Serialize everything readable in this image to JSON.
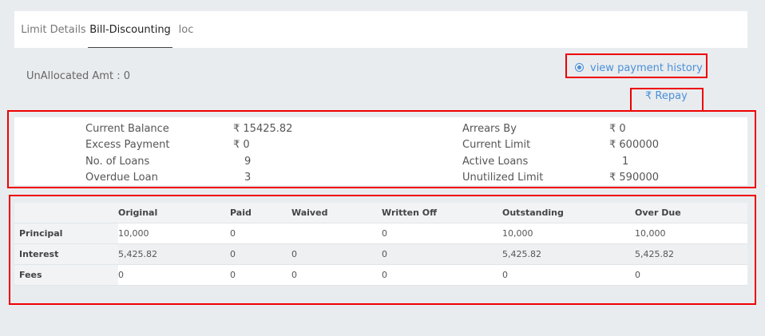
{
  "tabs": [
    {
      "label": "Limit Details",
      "active": false
    },
    {
      "label": "Bill-Discounting",
      "active": true
    },
    {
      "label": "loc",
      "active": false
    }
  ],
  "unallocated": "UnAllocated Amt : 0",
  "view_payment_history": "view payment history",
  "repay_label": "₹ Repay",
  "summary": {
    "left": [
      {
        "label": "Current Balance",
        "value": "₹  15425.82"
      },
      {
        "label": "Excess Payment",
        "value": "₹  0"
      },
      {
        "label": "No. of Loans",
        "value": "9"
      },
      {
        "label": "Overdue Loan",
        "value": "3"
      }
    ],
    "right": [
      {
        "label": "Arrears By",
        "value": "₹  0"
      },
      {
        "label": "Current Limit",
        "value": "₹  600000"
      },
      {
        "label": "Active Loans",
        "value": "1"
      },
      {
        "label": "Unutilized Limit",
        "value": "₹  590000"
      }
    ]
  },
  "table": {
    "headers": [
      "",
      "Original",
      "Paid",
      "Waived",
      "Written Off",
      "Outstanding",
      "Over Due"
    ],
    "rows": [
      [
        "Principal",
        "10,000",
        "0",
        "",
        "0",
        "10,000",
        "10,000"
      ],
      [
        "Interest",
        "5,425.82",
        "0",
        "0",
        "0",
        "5,425.82",
        "5,425.82"
      ],
      [
        "Fees",
        "0",
        "0",
        "0",
        "0",
        "0",
        "0"
      ]
    ]
  },
  "colors": {
    "accent": "#4a90d9",
    "highlight": "#e00000"
  }
}
